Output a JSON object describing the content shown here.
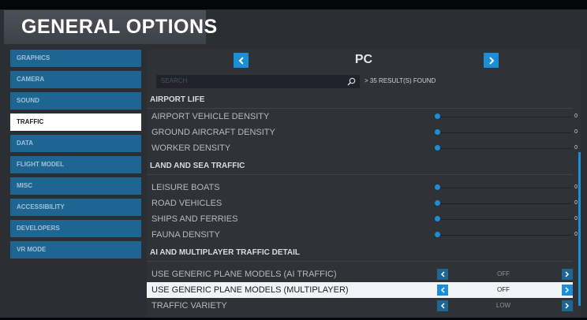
{
  "header": {
    "title": "GENERAL OPTIONS"
  },
  "sidebar": {
    "items": [
      {
        "label": "GRAPHICS",
        "active": false
      },
      {
        "label": "CAMERA",
        "active": false
      },
      {
        "label": "SOUND",
        "active": false
      },
      {
        "label": "TRAFFIC",
        "active": true
      },
      {
        "label": "DATA",
        "active": false
      },
      {
        "label": "FLIGHT MODEL",
        "active": false
      },
      {
        "label": "MISC",
        "active": false
      },
      {
        "label": "ACCESSIBILITY",
        "active": false
      },
      {
        "label": "DEVELOPERS",
        "active": false
      },
      {
        "label": "VR MODE",
        "active": false
      }
    ]
  },
  "platform": {
    "title": "PC"
  },
  "search": {
    "placeholder": "SEARCH",
    "result_count": "> 35 RESULT(S) FOUND"
  },
  "sections": [
    {
      "title": "AIRPORT LIFE",
      "rows": [
        {
          "label": "AIRPORT VEHICLE DENSITY",
          "value": "0"
        },
        {
          "label": "GROUND AIRCRAFT DENSITY",
          "value": "0"
        },
        {
          "label": "WORKER DENSITY",
          "value": "0"
        }
      ]
    },
    {
      "title": "LAND AND SEA TRAFFIC",
      "rows": [
        {
          "label": "LEISURE BOATS",
          "value": "0"
        },
        {
          "label": "ROAD VEHICLES",
          "value": "0"
        },
        {
          "label": "SHIPS AND FERRIES",
          "value": "0"
        },
        {
          "label": "FAUNA DENSITY",
          "value": "0"
        }
      ]
    },
    {
      "title": "AI AND MULTIPLAYER TRAFFIC DETAIL",
      "rows": [
        {
          "label": "USE GENERIC PLANE MODELS (AI TRAFFIC)",
          "value": "OFF"
        },
        {
          "label": "USE GENERIC PLANE MODELS (MULTIPLAYER)",
          "value": "OFF"
        },
        {
          "label": "TRAFFIC VARIETY",
          "value": "LOW"
        }
      ]
    }
  ],
  "colors": {
    "accent": "#1a8ed6",
    "sidebar_item": "#1f6591",
    "active": "#ffffff"
  }
}
